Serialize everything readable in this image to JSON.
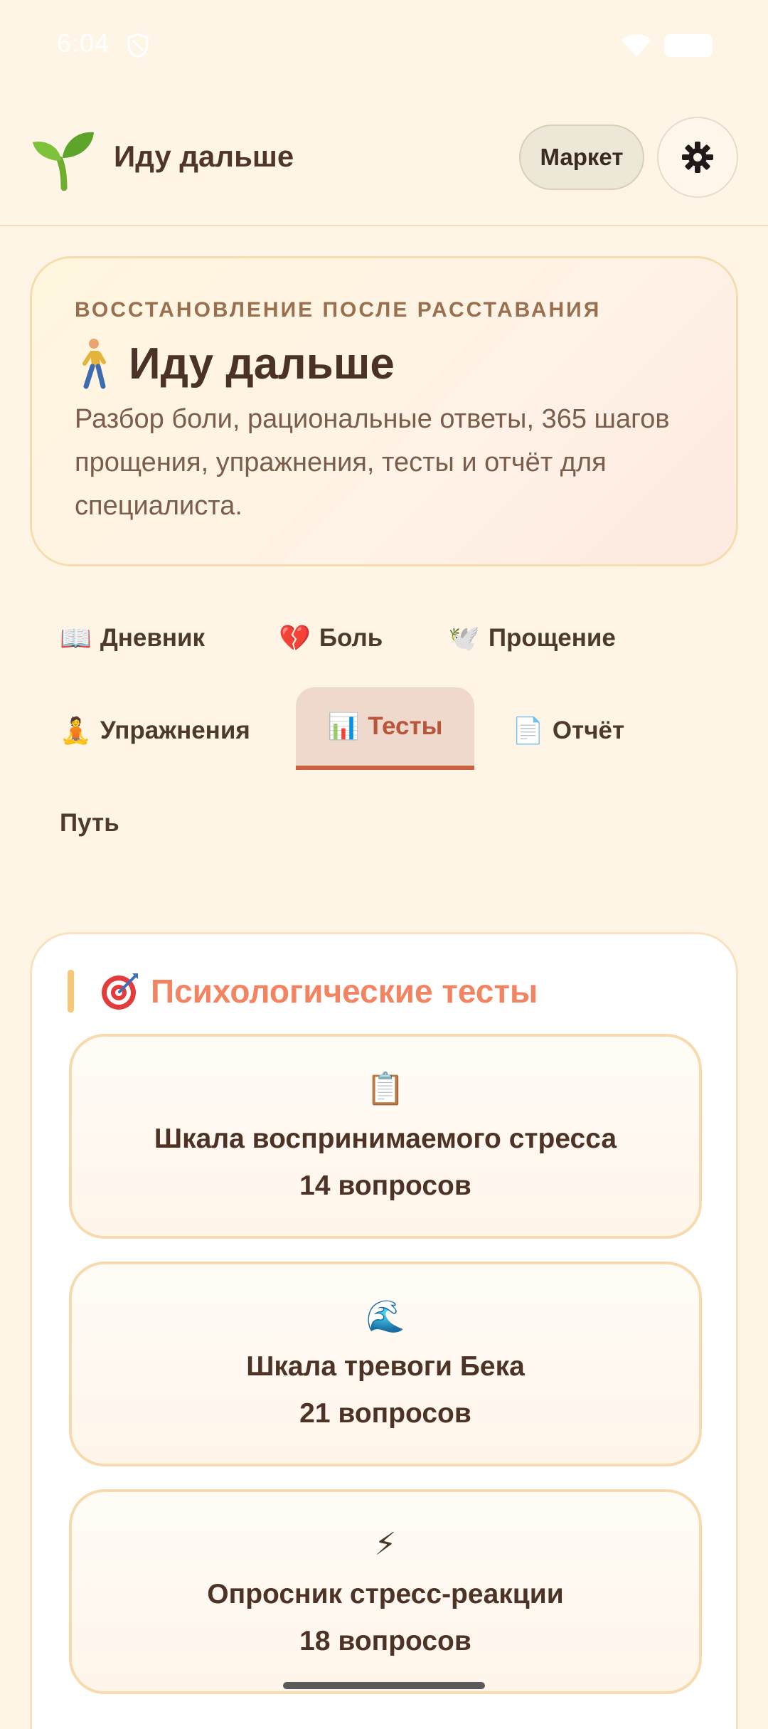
{
  "status_bar": {
    "time": "6:04"
  },
  "header": {
    "title": "Иду дальше",
    "market_label": "Маркет"
  },
  "hero": {
    "overline": "ВОССТАНОВЛЕНИЕ ПОСЛЕ РАССТАВАНИЯ",
    "title": "Иду дальше",
    "description": "Разбор боли, рациональные ответы, 365 шагов прощения, упражнения, тесты и отчёт для специалиста."
  },
  "tabs": [
    {
      "emoji": "📖",
      "label": "Дневник"
    },
    {
      "emoji": "💔",
      "label": "Боль"
    },
    {
      "emoji": "🕊️",
      "label": "Прощение"
    },
    {
      "emoji": "🧘",
      "label": "Упражнения"
    },
    {
      "emoji": "📊",
      "label": "Тесты"
    },
    {
      "emoji": "📄",
      "label": "Отчёт"
    },
    {
      "emoji": "",
      "label": "Путь"
    }
  ],
  "active_tab": "Тесты",
  "tests_section": {
    "title": "Психологические тесты",
    "items": [
      {
        "icon": "📋",
        "name": "Шкала воспринимаемого стресса",
        "count": "14 вопросов"
      },
      {
        "icon": "🌊",
        "name": "Шкала тревоги Бека",
        "count": "21 вопросов"
      },
      {
        "icon": "⚡",
        "name": "Опросник стресс-реакции",
        "count": "18 вопросов"
      }
    ]
  },
  "colors": {
    "background": "#fff5e7",
    "accent": "#c9623f",
    "section_title": "#f28462",
    "active_tab_bg": "#efd9cc"
  }
}
